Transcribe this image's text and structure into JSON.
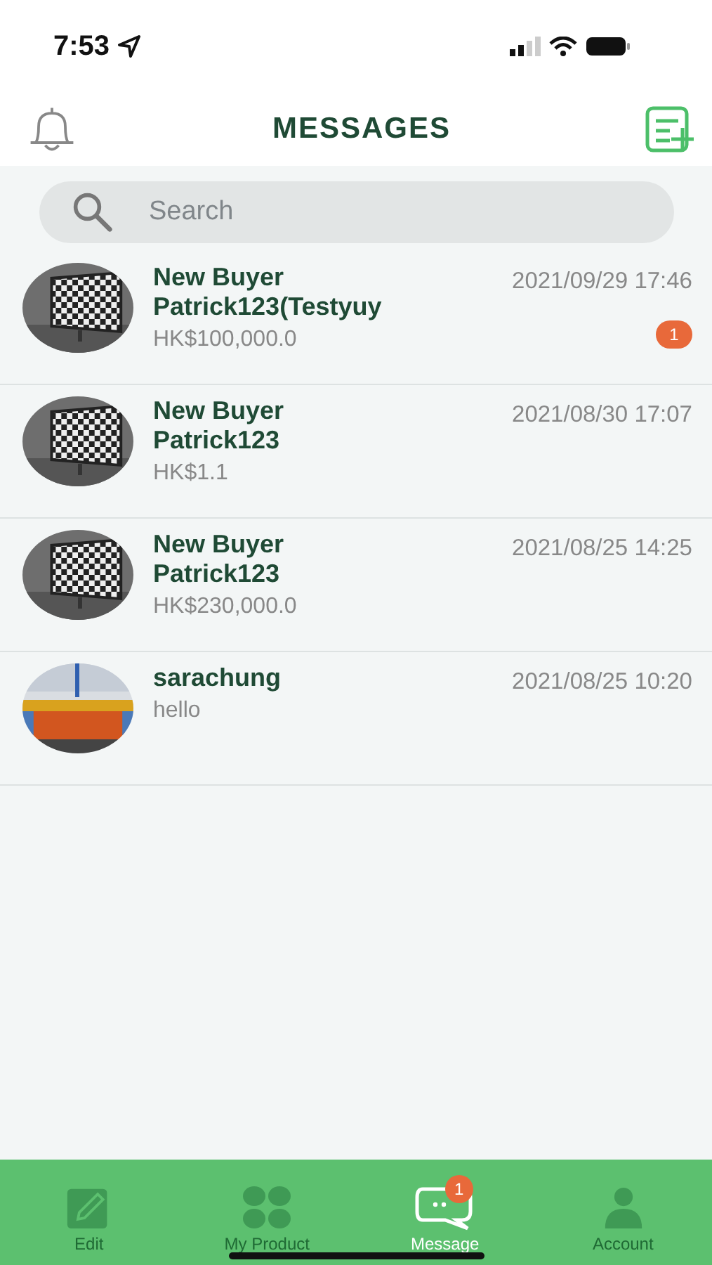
{
  "status_bar": {
    "time": "7:53"
  },
  "header": {
    "title": "MESSAGES"
  },
  "search": {
    "placeholder": "Search"
  },
  "conversations": [
    {
      "name": "New Buyer\nPatrick123(Testyuy",
      "preview": "HK$100,000.0",
      "time": "2021/09/29 17:46",
      "unread": "1"
    },
    {
      "name": "New Buyer\nPatrick123",
      "preview": "HK$1.1",
      "time": "2021/08/30 17:07"
    },
    {
      "name": "New Buyer\nPatrick123",
      "preview": "HK$230,000.0",
      "time": "2021/08/25 14:25"
    },
    {
      "name": "sarachung",
      "preview": "hello",
      "time": "2021/08/25 10:20"
    }
  ],
  "tab_bar": [
    {
      "label": "Edit",
      "kind": "edit",
      "selected": false
    },
    {
      "label": "My Product",
      "kind": "grid",
      "selected": false
    },
    {
      "label": "Message",
      "kind": "chat",
      "selected": true,
      "badge": "1"
    },
    {
      "label": "Account",
      "kind": "person",
      "selected": false
    }
  ]
}
